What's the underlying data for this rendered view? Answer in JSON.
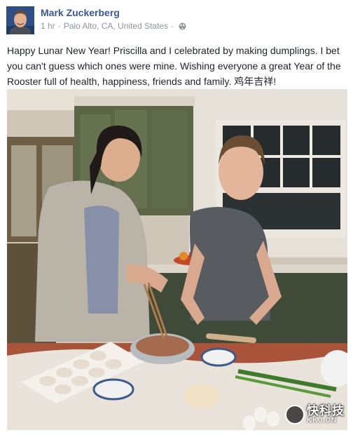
{
  "post": {
    "author": "Mark Zuckerberg",
    "time": "1 hr",
    "separator": "·",
    "location": "Palo Alto, CA, United States",
    "separator2": "·",
    "audience_icon": "globe-icon",
    "text": "Happy Lunar New Year! Priscilla and I celebrated by making dumplings. I bet you can't guess which ones were mine. Wishing everyone a great Year of the Rooster full of health, happiness, friends and family. 鸡年吉祥!"
  },
  "watermark": {
    "name": "快科技",
    "url": "KKJ.CN"
  },
  "colors": {
    "author_link": "#365899",
    "meta_text": "#90949c",
    "body_text": "#1d2129"
  }
}
